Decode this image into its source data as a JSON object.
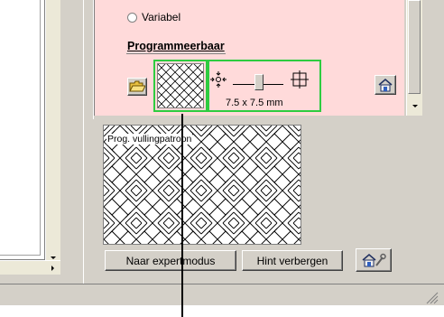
{
  "panel": {
    "radio_variable_label": "Variabel",
    "section_title": "Programmeerbaar",
    "size_readout": "7.5 x 7.5 mm",
    "preview_label": "Prog. vullingpatroon",
    "expert_button": "Naar expertmodus",
    "hide_hint_button": "Hint verbergen"
  },
  "icons": {
    "open_folder": "open-folder-icon",
    "pattern_thumb": "diagonal-weave-pattern-icon",
    "shrink": "shrink-arrows-icon",
    "expand": "expand-arrows-icon",
    "home": "home-icon",
    "home_settings": "home-wrench-icon"
  },
  "colors": {
    "panel_pink": "#ffdada",
    "highlight_green": "#2ecc40",
    "face": "#d4d0c8"
  }
}
